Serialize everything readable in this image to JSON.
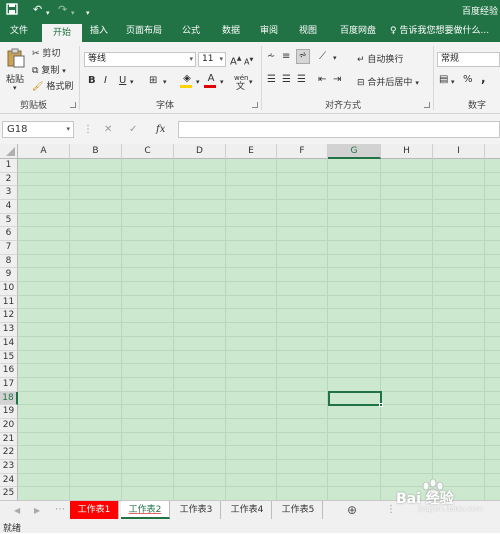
{
  "titlebar": {
    "title": "百度经验",
    "save_icon": "save-icon",
    "undo_icon": "undo-icon",
    "redo_icon": "redo-icon"
  },
  "tabs": [
    "文件",
    "开始",
    "插入",
    "页面布局",
    "公式",
    "数据",
    "审阅",
    "视图",
    "百度网盘"
  ],
  "tell_me": "告诉我您想要做什么...",
  "clipboard": {
    "paste": "粘贴",
    "cut": "剪切",
    "copy": "复制",
    "format_painter": "格式刷",
    "label": "剪贴板"
  },
  "font": {
    "name": "等线",
    "size": "11",
    "bold": "B",
    "italic": "I",
    "underline": "U",
    "grow": "A",
    "shrink": "A",
    "color": "A",
    "wen": "wén",
    "label": "字体"
  },
  "alignment": {
    "wrap": "自动换行",
    "merge": "合并后居中",
    "label": "对齐方式"
  },
  "number": {
    "format": "常规",
    "percent": "%",
    "comma": ",",
    "label": "数字"
  },
  "formula_bar": {
    "cell_ref": "G18",
    "cancel": "✕",
    "enter": "✓",
    "fx": "fx",
    "value": ""
  },
  "grid": {
    "columns": [
      "A",
      "B",
      "C",
      "D",
      "E",
      "F",
      "G",
      "H",
      "I"
    ],
    "rows": [
      "1",
      "2",
      "3",
      "4",
      "5",
      "6",
      "7",
      "8",
      "9",
      "10",
      "11",
      "12",
      "13",
      "14",
      "15",
      "16",
      "17",
      "18",
      "19",
      "20",
      "21",
      "22",
      "23",
      "24",
      "25"
    ],
    "selected_column": "G",
    "selected_row": "18",
    "fill_color": "#cce8cf"
  },
  "sheets": [
    {
      "name": "工作表1",
      "style": "red"
    },
    {
      "name": "工作表2",
      "style": "active"
    },
    {
      "name": "工作表3",
      "style": "plain"
    },
    {
      "name": "工作表4",
      "style": "plain"
    },
    {
      "name": "工作表5",
      "style": "plain"
    }
  ],
  "add_sheet": "⊕",
  "status": "就绪",
  "watermark": {
    "text": "Bai 经验",
    "sub": "jingyan.baidu.com"
  },
  "colors": {
    "excel_green": "#217346",
    "sheet_red": "#ff0000",
    "grid_green": "#cce8cf"
  }
}
